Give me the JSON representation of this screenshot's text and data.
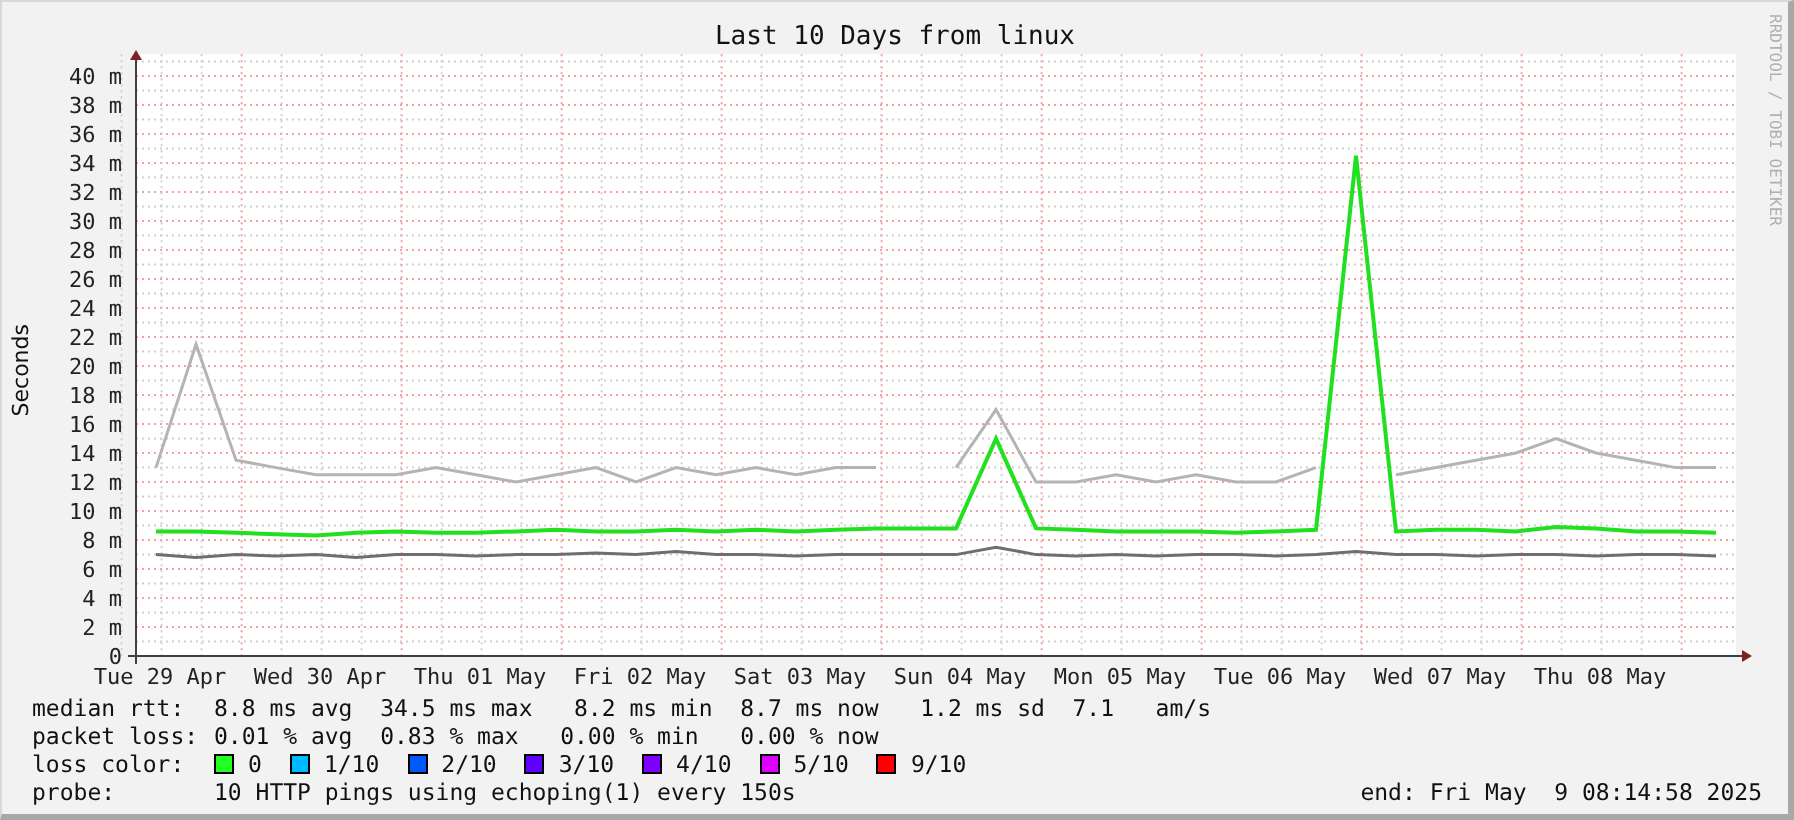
{
  "credit": "RRDTOOL / TOBI OETIKER",
  "chart_data": {
    "type": "line",
    "grid": true,
    "title": "Last 10 Days from linux",
    "ylabel": "Seconds",
    "ylim": [
      0,
      41.5
    ],
    "categories": [
      "Tue 29 Apr",
      null,
      null,
      null,
      "Wed 30 Apr",
      null,
      null,
      null,
      "Thu 01 May",
      null,
      null,
      null,
      "Fri 02 May",
      null,
      null,
      null,
      "Sat 03 May",
      null,
      null,
      null,
      "Sun 04 May",
      null,
      null,
      null,
      "Mon 05 May",
      null,
      null,
      null,
      "Tue 06 May",
      null,
      null,
      null,
      "Wed 07 May",
      null,
      null,
      null,
      "Thu 08 May",
      null,
      null,
      null
    ],
    "yticks": [
      {
        "value": 0,
        "label": "0"
      },
      {
        "value": 2,
        "label": "2 m"
      },
      {
        "value": 4,
        "label": "4 m"
      },
      {
        "value": 6,
        "label": "6 m"
      },
      {
        "value": 8,
        "label": "8 m"
      },
      {
        "value": 10,
        "label": "10 m"
      },
      {
        "value": 12,
        "label": "12 m"
      },
      {
        "value": 14,
        "label": "14 m"
      },
      {
        "value": 16,
        "label": "16 m"
      },
      {
        "value": 18,
        "label": "18 m"
      },
      {
        "value": 20,
        "label": "20 m"
      },
      {
        "value": 22,
        "label": "22 m"
      },
      {
        "value": 24,
        "label": "24 m"
      },
      {
        "value": 26,
        "label": "26 m"
      },
      {
        "value": 28,
        "label": "28 m"
      },
      {
        "value": 30,
        "label": "30 m"
      },
      {
        "value": 32,
        "label": "32 m"
      },
      {
        "value": 34,
        "label": "34 m"
      },
      {
        "value": 36,
        "label": "36 m"
      },
      {
        "value": 38,
        "label": "38 m"
      },
      {
        "value": 40,
        "label": "40 m"
      }
    ],
    "series": [
      {
        "color": "#b4b4b4",
        "values": [
          13,
          21.5,
          13.5,
          13,
          12.5,
          12.5,
          12.5,
          13,
          12.5,
          12,
          12.5,
          13,
          12,
          13,
          12.5,
          13,
          12.5,
          13,
          13,
          null,
          13,
          17,
          12,
          12,
          12.5,
          12,
          12.5,
          12,
          12,
          13,
          null,
          12.5,
          13,
          13.5,
          14,
          15,
          14,
          13.5,
          13,
          13
        ]
      },
      {
        "color": "#6e6e6e",
        "values": [
          7,
          6.8,
          7,
          6.9,
          7,
          6.8,
          7,
          7,
          6.9,
          7,
          7,
          7.1,
          7,
          7.2,
          7,
          7,
          6.9,
          7,
          7,
          7,
          7,
          7.5,
          7,
          6.9,
          7,
          6.9,
          7,
          7,
          6.9,
          7,
          7.2,
          7,
          7,
          6.9,
          7,
          7,
          6.9,
          7,
          7,
          6.9
        ]
      },
      {
        "color": "#20e020",
        "values": [
          8.6,
          8.6,
          8.5,
          8.4,
          8.3,
          8.5,
          8.6,
          8.5,
          8.5,
          8.6,
          8.7,
          8.6,
          8.6,
          8.7,
          8.6,
          8.7,
          8.6,
          8.7,
          8.8,
          8.8,
          8.8,
          15,
          8.8,
          8.7,
          8.6,
          8.6,
          8.6,
          8.5,
          8.6,
          8.7,
          34.5,
          8.6,
          8.7,
          8.7,
          8.6,
          8.9,
          8.8,
          8.6,
          8.6,
          8.5
        ]
      }
    ]
  },
  "legend": {
    "median_rtt": {
      "label": "median rtt:",
      "text": "8.8 ms avg  34.5 ms max   8.2 ms min  8.7 ms now   1.2 ms sd  7.1   am/s"
    },
    "packet_loss": {
      "label": "packet loss:",
      "text": "0.01 % avg  0.83 % max   0.00 % min   0.00 % now"
    },
    "loss_color": {
      "label": "loss color:",
      "items": [
        {
          "label": "0",
          "color": "#20ff20"
        },
        {
          "label": "1/10",
          "color": "#00b8ff"
        },
        {
          "label": "2/10",
          "color": "#0059ff"
        },
        {
          "label": "3/10",
          "color": "#5e00ff"
        },
        {
          "label": "4/10",
          "color": "#7e00ff"
        },
        {
          "label": "5/10",
          "color": "#dd00ff"
        },
        {
          "label": "9/10",
          "color": "#ff0000"
        }
      ]
    },
    "probe": {
      "label": "probe:",
      "text": "10 HTTP pings using echoping(1) every 150s"
    },
    "end": "end: Fri May  9 08:14:58 2025"
  }
}
